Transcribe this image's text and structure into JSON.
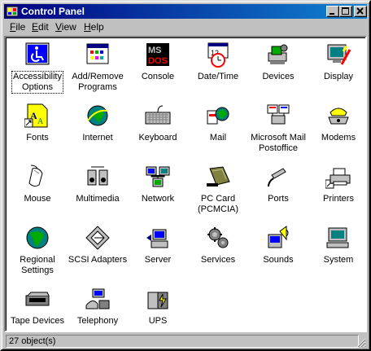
{
  "window": {
    "title": "Control Panel"
  },
  "menu": [
    {
      "label": "File",
      "u": "F",
      "rest": "ile"
    },
    {
      "label": "Edit",
      "u": "E",
      "rest": "dit"
    },
    {
      "label": "View",
      "u": "V",
      "rest": "iew"
    },
    {
      "label": "Help",
      "u": "H",
      "rest": "elp"
    }
  ],
  "items": [
    {
      "l1": "Accessibility",
      "l2": "Options",
      "icon": "accessibility-icon",
      "selected": true
    },
    {
      "l1": "Add/Remove",
      "l2": "Programs",
      "icon": "add-remove-programs-icon"
    },
    {
      "l1": "Console",
      "l2": "",
      "icon": "console-icon"
    },
    {
      "l1": "Date/Time",
      "l2": "",
      "icon": "date-time-icon"
    },
    {
      "l1": "Devices",
      "l2": "",
      "icon": "devices-icon"
    },
    {
      "l1": "Display",
      "l2": "",
      "icon": "display-icon"
    },
    {
      "l1": "Fonts",
      "l2": "",
      "icon": "fonts-icon"
    },
    {
      "l1": "Internet",
      "l2": "",
      "icon": "internet-icon"
    },
    {
      "l1": "Keyboard",
      "l2": "",
      "icon": "keyboard-icon"
    },
    {
      "l1": "Mail",
      "l2": "",
      "icon": "mail-icon"
    },
    {
      "l1": "Microsoft Mail",
      "l2": "Postoffice",
      "icon": "mail-postoffice-icon"
    },
    {
      "l1": "Modems",
      "l2": "",
      "icon": "modem-icon"
    },
    {
      "l1": "Mouse",
      "l2": "",
      "icon": "mouse-icon"
    },
    {
      "l1": "Multimedia",
      "l2": "",
      "icon": "multimedia-icon"
    },
    {
      "l1": "Network",
      "l2": "",
      "icon": "network-icon"
    },
    {
      "l1": "PC Card",
      "l2": "(PCMCIA)",
      "icon": "pc-card-icon"
    },
    {
      "l1": "Ports",
      "l2": "",
      "icon": "ports-icon"
    },
    {
      "l1": "Printers",
      "l2": "",
      "icon": "printer-icon"
    },
    {
      "l1": "Regional",
      "l2": "Settings",
      "icon": "globe-icon"
    },
    {
      "l1": "SCSI Adapters",
      "l2": "",
      "icon": "scsi-icon"
    },
    {
      "l1": "Server",
      "l2": "",
      "icon": "server-icon"
    },
    {
      "l1": "Services",
      "l2": "",
      "icon": "services-icon"
    },
    {
      "l1": "Sounds",
      "l2": "",
      "icon": "sounds-icon"
    },
    {
      "l1": "System",
      "l2": "",
      "icon": "system-icon"
    },
    {
      "l1": "Tape Devices",
      "l2": "",
      "icon": "tape-device-icon"
    },
    {
      "l1": "Telephony",
      "l2": "",
      "icon": "telephony-icon"
    },
    {
      "l1": "UPS",
      "l2": "",
      "icon": "ups-icon"
    }
  ],
  "status": {
    "text": "27 object(s)"
  },
  "colors": {
    "titlebar": "#000080",
    "face": "#c0c0c0",
    "selection_outline": "#000000"
  }
}
